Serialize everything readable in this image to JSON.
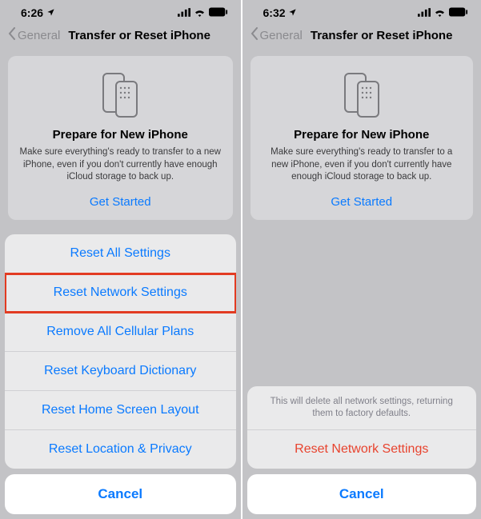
{
  "left": {
    "status_time": "6:26",
    "nav_back": "General",
    "nav_title": "Transfer or Reset iPhone",
    "card": {
      "title": "Prepare for New iPhone",
      "desc": "Make sure everything's ready to transfer to a new iPhone, even if you don't currently have enough iCloud storage to back up.",
      "cta": "Get Started"
    },
    "sheet": {
      "items": [
        "Reset All Settings",
        "Reset Network Settings",
        "Remove All Cellular Plans",
        "Reset Keyboard Dictionary",
        "Reset Home Screen Layout",
        "Reset Location & Privacy"
      ],
      "cancel": "Cancel"
    }
  },
  "right": {
    "status_time": "6:32",
    "nav_back": "General",
    "nav_title": "Transfer or Reset iPhone",
    "card": {
      "title": "Prepare for New iPhone",
      "desc": "Make sure everything's ready to transfer to a new iPhone, even if you don't currently have enough iCloud storage to back up.",
      "cta": "Get Started"
    },
    "confirm": {
      "message": "This will delete all network settings, returning them to factory defaults.",
      "action": "Reset Network Settings",
      "cancel": "Cancel"
    }
  },
  "colors": {
    "blue": "#0a7aff",
    "red": "#e8432e",
    "highlight_border": "#e23b22"
  }
}
